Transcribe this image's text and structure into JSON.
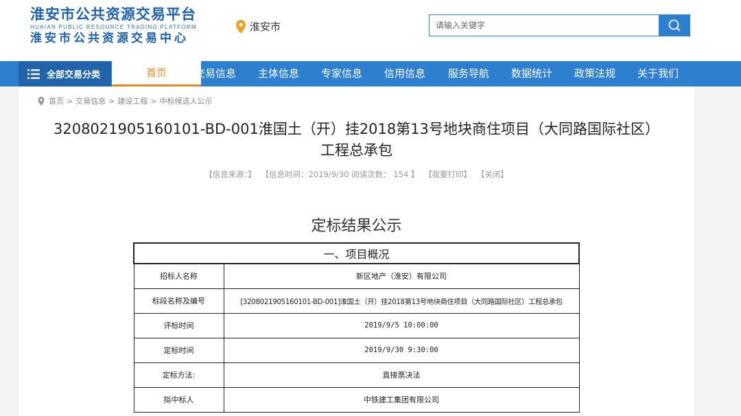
{
  "header": {
    "logo_cn_top": "淮安市公共资源交易平台",
    "logo_en": "HUAIAN PUBLIC RESOURCE TRADING PLATFORM",
    "logo_cn_bottom": "淮安市公共资源交易中心",
    "city": "淮安市",
    "search_placeholder": "请输入关键字"
  },
  "nav": {
    "all_categories": "全部交易分类",
    "items": [
      "首页",
      "交易信息",
      "主体信息",
      "专家信息",
      "信用信息",
      "服务导航",
      "数据统计",
      "政策法规",
      "关于我们"
    ],
    "active": "首页"
  },
  "breadcrumb": [
    "首页",
    "交易信息",
    "建设工程",
    "中标候选人公示"
  ],
  "article": {
    "title_line1": "3208021905160101-BD-001淮国土（开）挂2018第13号地块商住项目（大同路国际社区）",
    "title_line2": "工程总承包",
    "meta_source": "【信息来源：】",
    "meta_time": "【信息时间：2019/9/30 阅读次数：  154 】",
    "meta_print": "【我要打印】",
    "meta_close": "【关闭】",
    "doc_title": "定标结果公示",
    "section_title": "一、项目概况",
    "rows": [
      {
        "label": "招标人名称",
        "value": "新区地产（淮安）有限公司"
      },
      {
        "label": "标段名称及编号",
        "value": "[3208021905160101-BD-001]淮国土（开）挂2018第13号地块商住项目（大同路国际社区）工程总承包"
      },
      {
        "label": "评标时间",
        "value": "2019/9/5 10:00:00"
      },
      {
        "label": "定标时间",
        "value": "2019/9/30 9:30:00"
      },
      {
        "label": "定标方法:",
        "value": "直接票决法"
      },
      {
        "label": "拟中标人",
        "value": "中铁建工集团有限公司"
      }
    ]
  },
  "colors": {
    "brand_blue": "#2d7fd0",
    "nav_dark": "#2264ac",
    "active_orange": "#e8891e",
    "pin_orange": "#f0a020"
  },
  "icons": [
    "map-pin-icon",
    "search-icon",
    "menu-icon",
    "location-icon"
  ]
}
